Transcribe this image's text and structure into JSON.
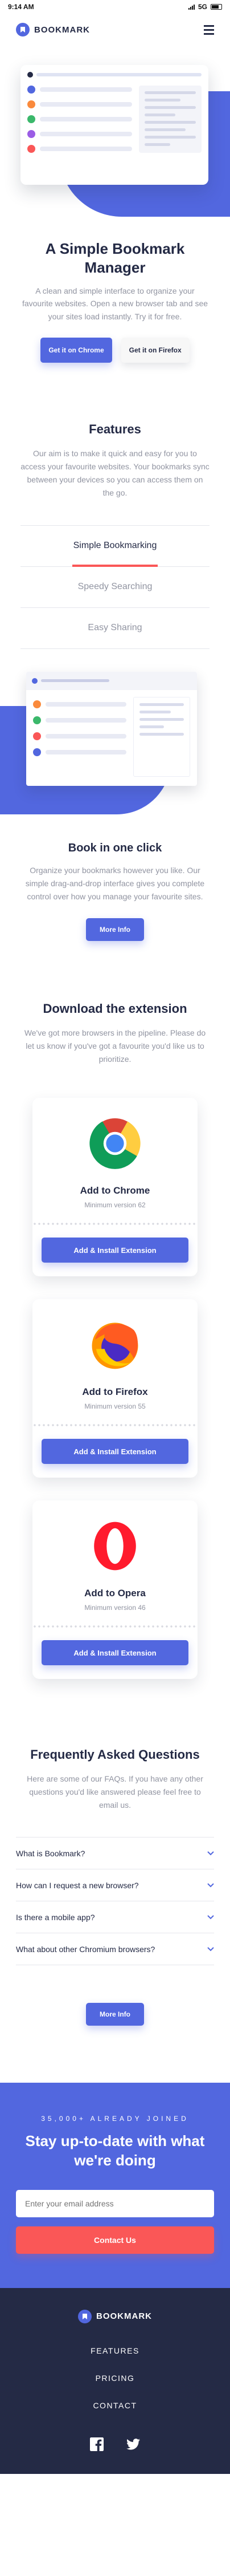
{
  "status_bar": {
    "time": "9:14 AM",
    "network": "5G"
  },
  "header": {
    "logo_text": "BOOKMARK",
    "menu_icon": "hamburger-menu-icon"
  },
  "hero": {
    "title": "A Simple Bookmark Manager",
    "description": "A clean and simple interface to organize your favourite websites. Open a new browser tab and see your sites load instantly. Try it for free.",
    "chrome_button": "Get it on Chrome",
    "firefox_button": "Get it on Firefox"
  },
  "features": {
    "title": "Features",
    "description": "Our aim is to make it quick and easy for you to access your favourite websites. Your bookmarks sync between your devices so you can access them on the go.",
    "tabs": [
      "Simple Bookmarking",
      "Speedy Searching",
      "Easy Sharing"
    ],
    "active_tab": "Simple Bookmarking",
    "panel": {
      "title": "Book in one click",
      "description": "Organize your bookmarks however you like. Our simple drag-and-drop interface gives you complete control over how you manage your favourite sites.",
      "button": "More Info"
    }
  },
  "extensions": {
    "title": "Download the extension",
    "description": "We've got more browsers in the pipeline. Please do let us know if you've got a favourite you'd like us to prioritize.",
    "cards": [
      {
        "name": "Add to Chrome",
        "version": "Minimum version 62",
        "button": "Add & Install Extension",
        "icon": "chrome-icon"
      },
      {
        "name": "Add to Firefox",
        "version": "Minimum version 55",
        "button": "Add & Install Extension",
        "icon": "firefox-icon"
      },
      {
        "name": "Add to Opera",
        "version": "Minimum version 46",
        "button": "Add & Install Extension",
        "icon": "opera-icon"
      }
    ]
  },
  "faq": {
    "title": "Frequently Asked Questions",
    "description": "Here are some of our FAQs. If you have any other questions you'd like answered please feel free to email us.",
    "questions": [
      "What is Bookmark?",
      "How can I request a new browser?",
      "Is there a mobile app?",
      "What about other Chromium browsers?"
    ],
    "button": "More Info"
  },
  "contact": {
    "kicker": "35,000+ ALREADY JOINED",
    "title": "Stay up-to-date with what we're doing",
    "email_placeholder": "Enter your email address",
    "button": "Contact Us"
  },
  "footer": {
    "logo_text": "BOOKMARK",
    "links": [
      "FEATURES",
      "PRICING",
      "CONTACT"
    ],
    "social": [
      "facebook-icon",
      "twitter-icon"
    ]
  },
  "colors": {
    "primary": "#5267df",
    "accent": "#fa5757",
    "dark": "#242a45",
    "muted": "#9194a1"
  }
}
